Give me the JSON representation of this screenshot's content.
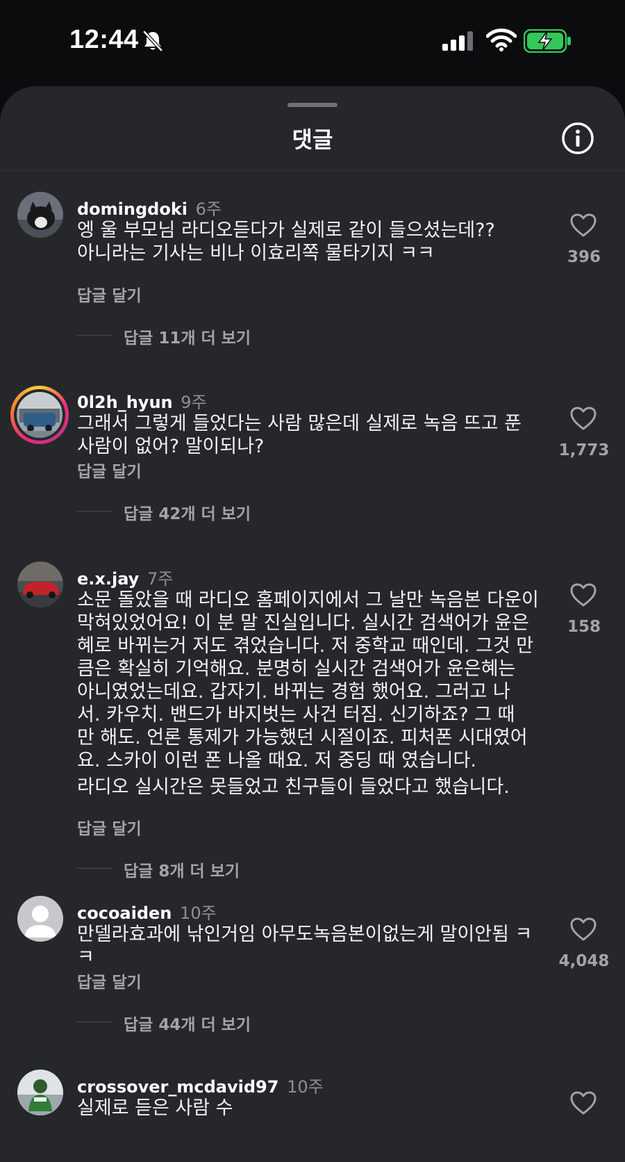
{
  "status_bar": {
    "time": "12:44",
    "icons": [
      "bell-slash-icon",
      "signal-icon",
      "wifi-icon",
      "battery-charging-icon"
    ]
  },
  "sheet": {
    "title": "댓글",
    "info_icon": "info-icon"
  },
  "comments": [
    {
      "username": "domingdoki",
      "time_ago": "6주",
      "text": "엥 울 부모님 라디오듣다가 실제로 같이 들으셨는데??\n아니라는 기사는 비나 이효리쪽 물타기지 ㅋㅋ",
      "reply_label": "답글 달기",
      "view_replies_label": "답글 11개 더 보기",
      "likes": "396"
    },
    {
      "username": "0l2h_hyun",
      "time_ago": "9주",
      "text": "그래서 그렇게 들었다는 사람 많은데 실제로 녹음 뜨고 푼\n사람이 없어? 말이되나?",
      "reply_label": "답글 달기",
      "view_replies_label": "답글 42개 더 보기",
      "likes": "1,773"
    },
    {
      "username": "e.x.jay",
      "time_ago": "7주",
      "text": "소문 돌았을 때 라디오 홈페이지에서 그 날만 녹음본 다운이\n막혀있었어요! 이 분 말 진실입니다. 실시간 검색어가 윤은\n혜로 바뀌는거 저도 겪었습니다. 저 중학교 때인데. 그것 만\n큼은 확실히 기억해요. 분명히 실시간 검색어가 윤은혜는\n아니였었는데요. 갑자기. 바뀌는 경험 했어요.  그러고 나\n서. 카우치. 밴드가 바지벗는 사건 터짐.  신기하죠?  그 때\n만 해도. 언론 통제가 가능했던 시절이죠.  피처폰 시대였어\n요. 스카이 이런 폰 나올 때요. 저 중딩 때 였습니다.",
      "text_extra": "라디오 실시간은 못들었고 친구들이 들었다고 했습니다.",
      "reply_label": "답글 달기",
      "view_replies_label": "답글 8개 더 보기",
      "likes": "158"
    },
    {
      "username": "cocoaiden",
      "time_ago": "10주",
      "text": "만델라효과에 낚인거임 아무도녹음본이없는게 말이안됨 ㅋ\nㅋ",
      "reply_label": "답글 달기",
      "view_replies_label": "답글 44개 더 보기",
      "likes": "4,048"
    },
    {
      "username": "crossover_mcdavid97",
      "time_ago": "10주",
      "text": "실제로 듣은 사람 수"
    }
  ],
  "colors": {
    "sheet_bg": "#25272b",
    "text_primary": "#f2f2f2",
    "text_secondary": "#a2a4a9",
    "battery_green": "#34c759"
  }
}
